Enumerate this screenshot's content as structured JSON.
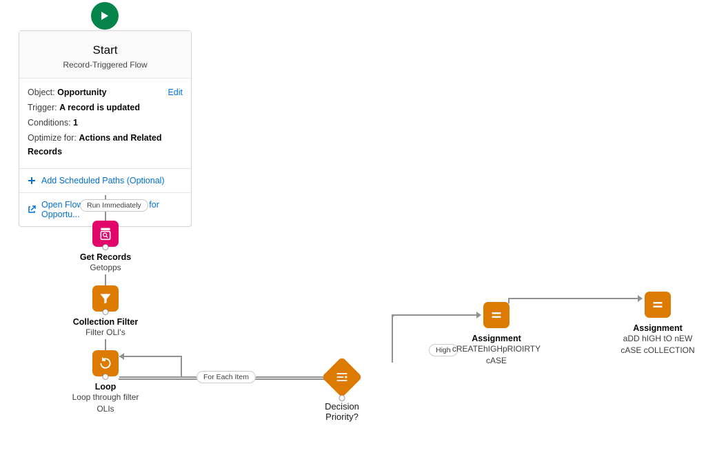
{
  "play_icon": "play-icon",
  "start": {
    "title": "Start",
    "subtitle": "Record-Triggered Flow",
    "object_label": "Object:",
    "object_value": "Opportunity",
    "trigger_label": "Trigger:",
    "trigger_value": "A record is updated",
    "conditions_label": "Conditions:",
    "conditions_value": "1",
    "optimize_label": "Optimize for:",
    "optimize_value": "Actions and Related Records",
    "edit_label": "Edit",
    "scheduled_paths_label": "Add Scheduled Paths (Optional)",
    "explorer_label": "Open Flow Trigger Explorer for Opportu..."
  },
  "connector_labels": {
    "run_immediately": "Run Immediately",
    "for_each_item": "For Each Item",
    "high": "High"
  },
  "nodes": {
    "get_records": {
      "title": "Get Records",
      "sub": "Getopps"
    },
    "collection_filter": {
      "title": "Collection Filter",
      "sub": "Filter OLI's"
    },
    "loop": {
      "title": "Loop",
      "sub1": "Loop through filter",
      "sub2": "OLIs"
    },
    "decision": {
      "title": "Decision",
      "sub": "Priority?"
    },
    "assignment1": {
      "title": "Assignment",
      "sub1": "cREATEhIGHpRIOIRTY",
      "sub2": "cASE"
    },
    "assignment2": {
      "title": "Assignment",
      "sub1": "aDD hIGH tO nEW",
      "sub2": "cASE cOLLECTION"
    }
  },
  "colors": {
    "play": "#04844b",
    "pink": "#e3066a",
    "orange": "#dd7a01",
    "link": "#0070d2"
  }
}
